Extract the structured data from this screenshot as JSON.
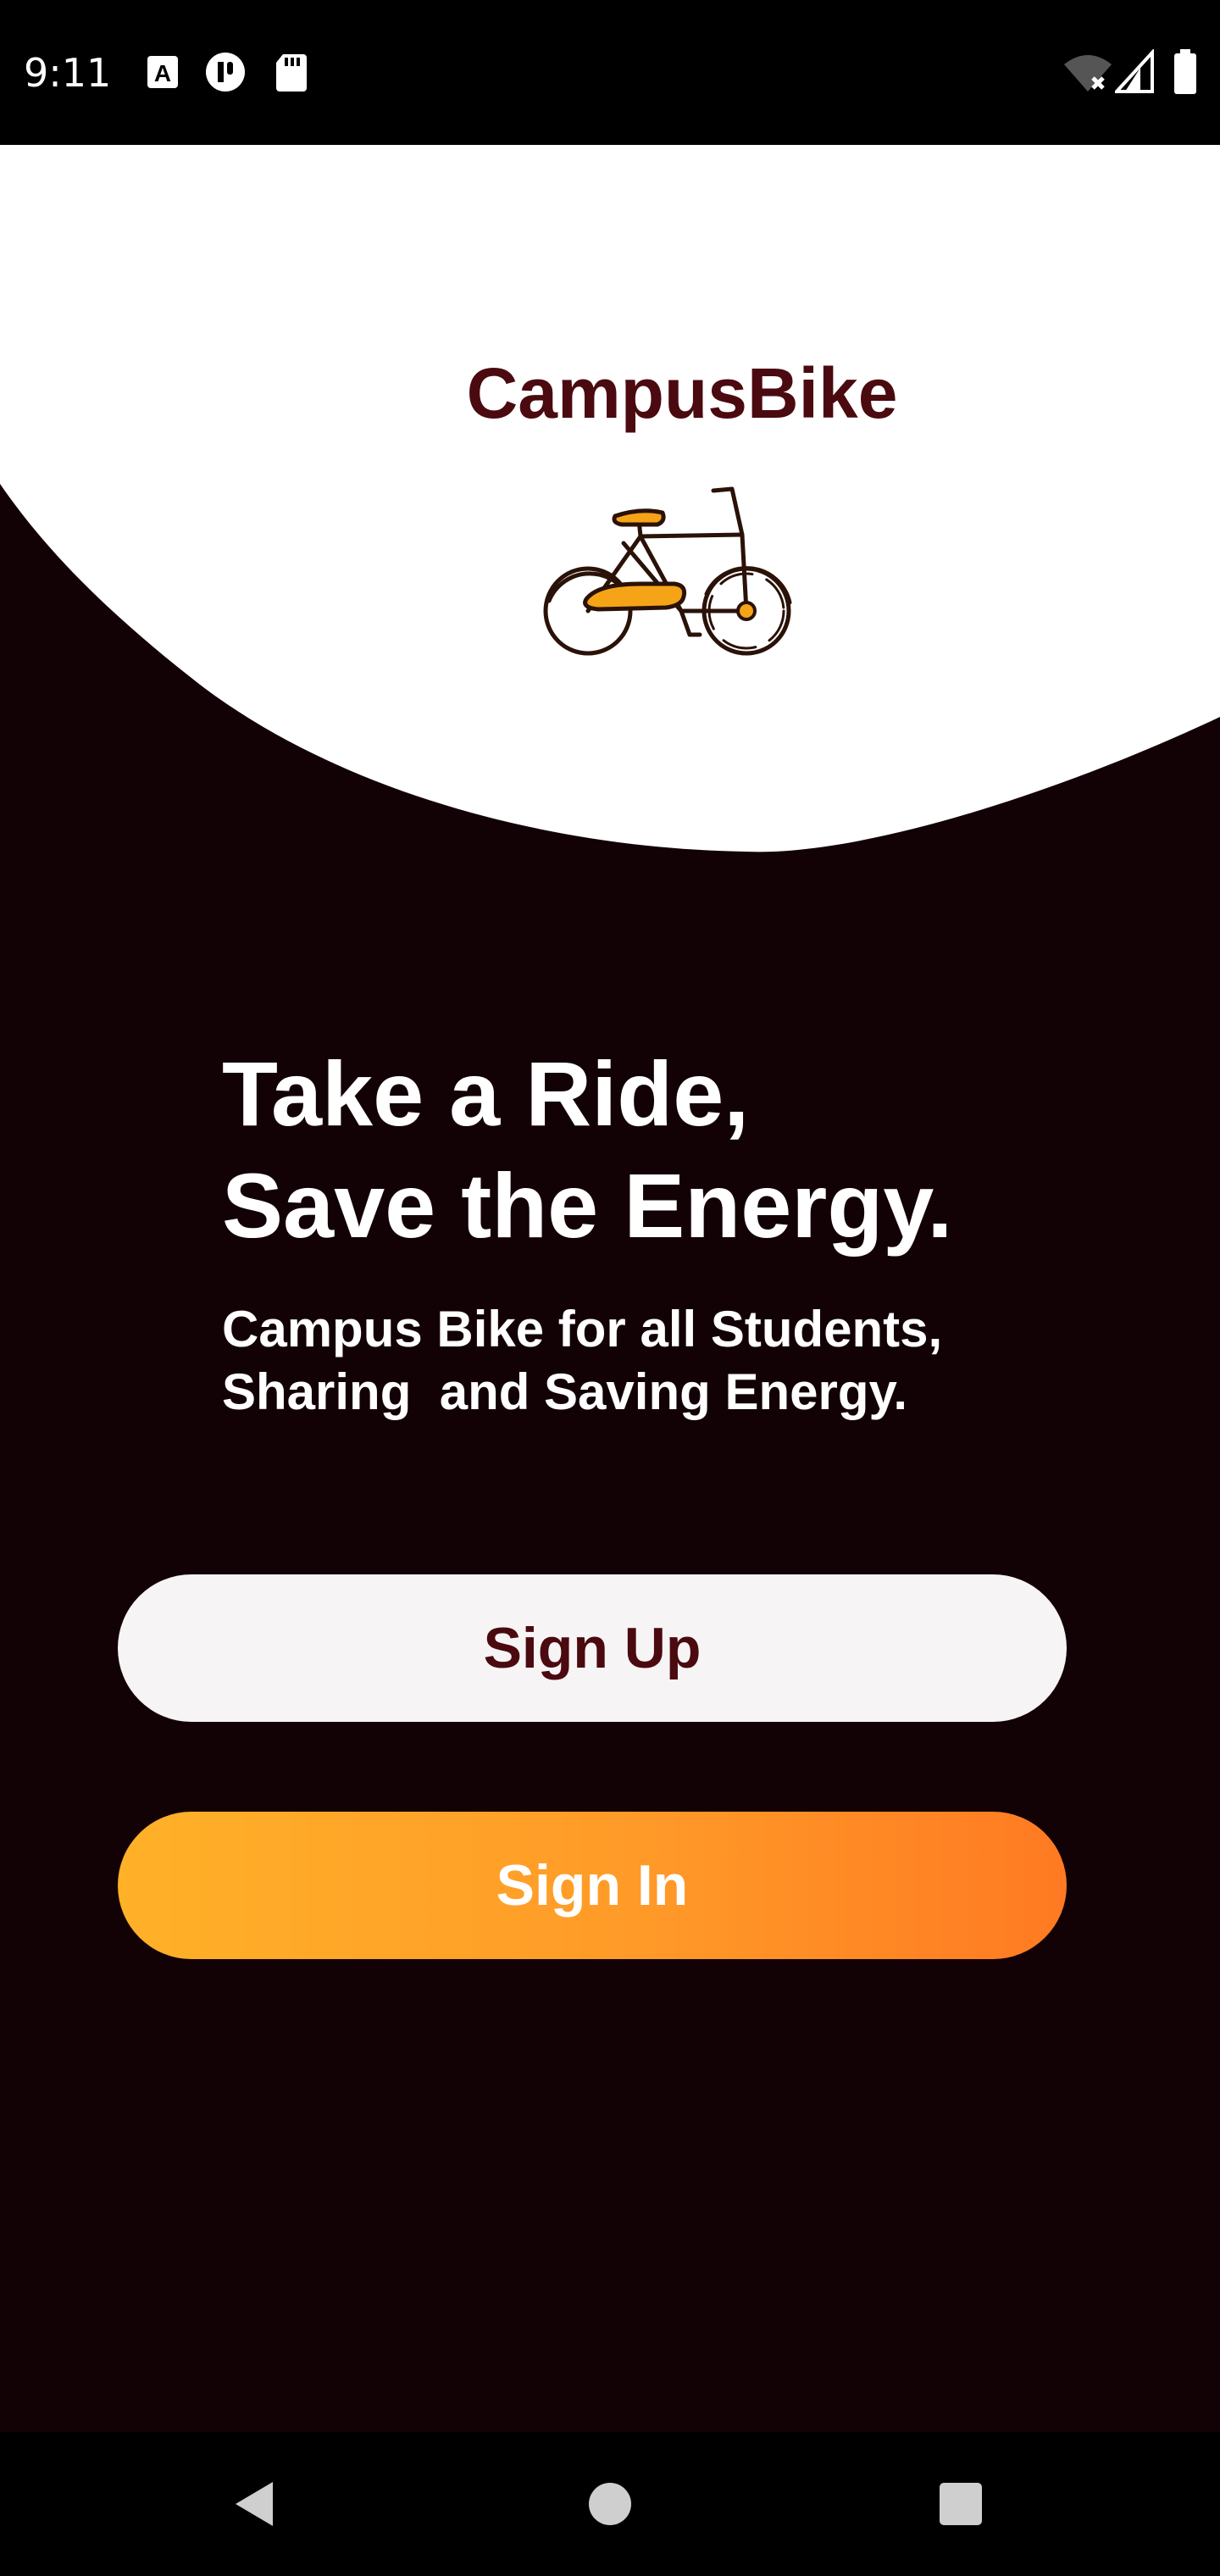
{
  "status_bar": {
    "time": "9:11",
    "left_icons": [
      "a-icon",
      "pause-icon",
      "sd-card-icon"
    ],
    "right_icons": [
      "wifi-off-icon",
      "signal-icon",
      "battery-icon"
    ]
  },
  "header": {
    "app_title": "CampusBike",
    "logo": "bike-icon"
  },
  "hero": {
    "headline_line1": "Take a Ride,",
    "headline_line2": "Save the Energy.",
    "subline": "Campus Bike for all Students,\nSharing  and Saving Energy."
  },
  "actions": {
    "signup_label": "Sign Up",
    "signin_label": "Sign In"
  },
  "nav_bar": {
    "buttons": [
      "back-icon",
      "home-icon",
      "recents-icon"
    ]
  },
  "colors": {
    "background": "#120206",
    "brand_text": "#4a0a10",
    "accent_start": "#ffb128",
    "accent_end": "#ff7a22",
    "bike_fill": "#f4a416"
  }
}
